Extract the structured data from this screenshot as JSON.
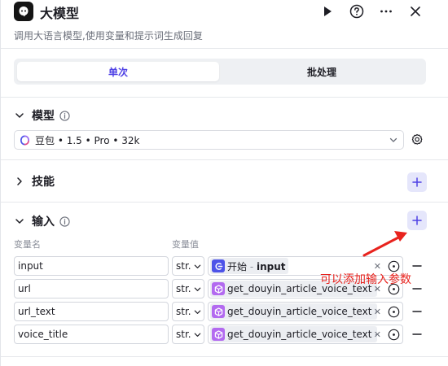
{
  "header": {
    "title": "大模型",
    "description": "调用大语言模型,使用变量和提示词生成回复"
  },
  "mode": {
    "single": "单次",
    "batch": "批处理"
  },
  "sections": {
    "model": "模型",
    "skills": "技能",
    "input": "输入"
  },
  "model_select": {
    "value": "豆包 • 1.5 • Pro • 32k"
  },
  "columns": {
    "name": "变量名",
    "value": "变量值"
  },
  "inputs": [
    {
      "name": "input",
      "type": "str.",
      "source": "开始",
      "sep": " - ",
      "variable": "input"
    },
    {
      "name": "url",
      "type": "str.",
      "source": "get_douyin_article_voice_text",
      "sep": " - ",
      "variable": ""
    },
    {
      "name": "url_text",
      "type": "str.",
      "source": "get_douyin_article_voice_text",
      "sep": " - ",
      "variable": ""
    },
    {
      "name": "voice_title",
      "type": "str.",
      "source": "get_douyin_article_voice_text",
      "sep": " - ",
      "variable": ""
    }
  ],
  "annotation": {
    "text": "可以添加输入参数",
    "color": "#e8231e"
  },
  "colors": {
    "accent": "#4e40e5",
    "add_bg": "#e5e6fb",
    "start_icon": "#4d53e8",
    "plugin_icon": "#b36af0"
  }
}
